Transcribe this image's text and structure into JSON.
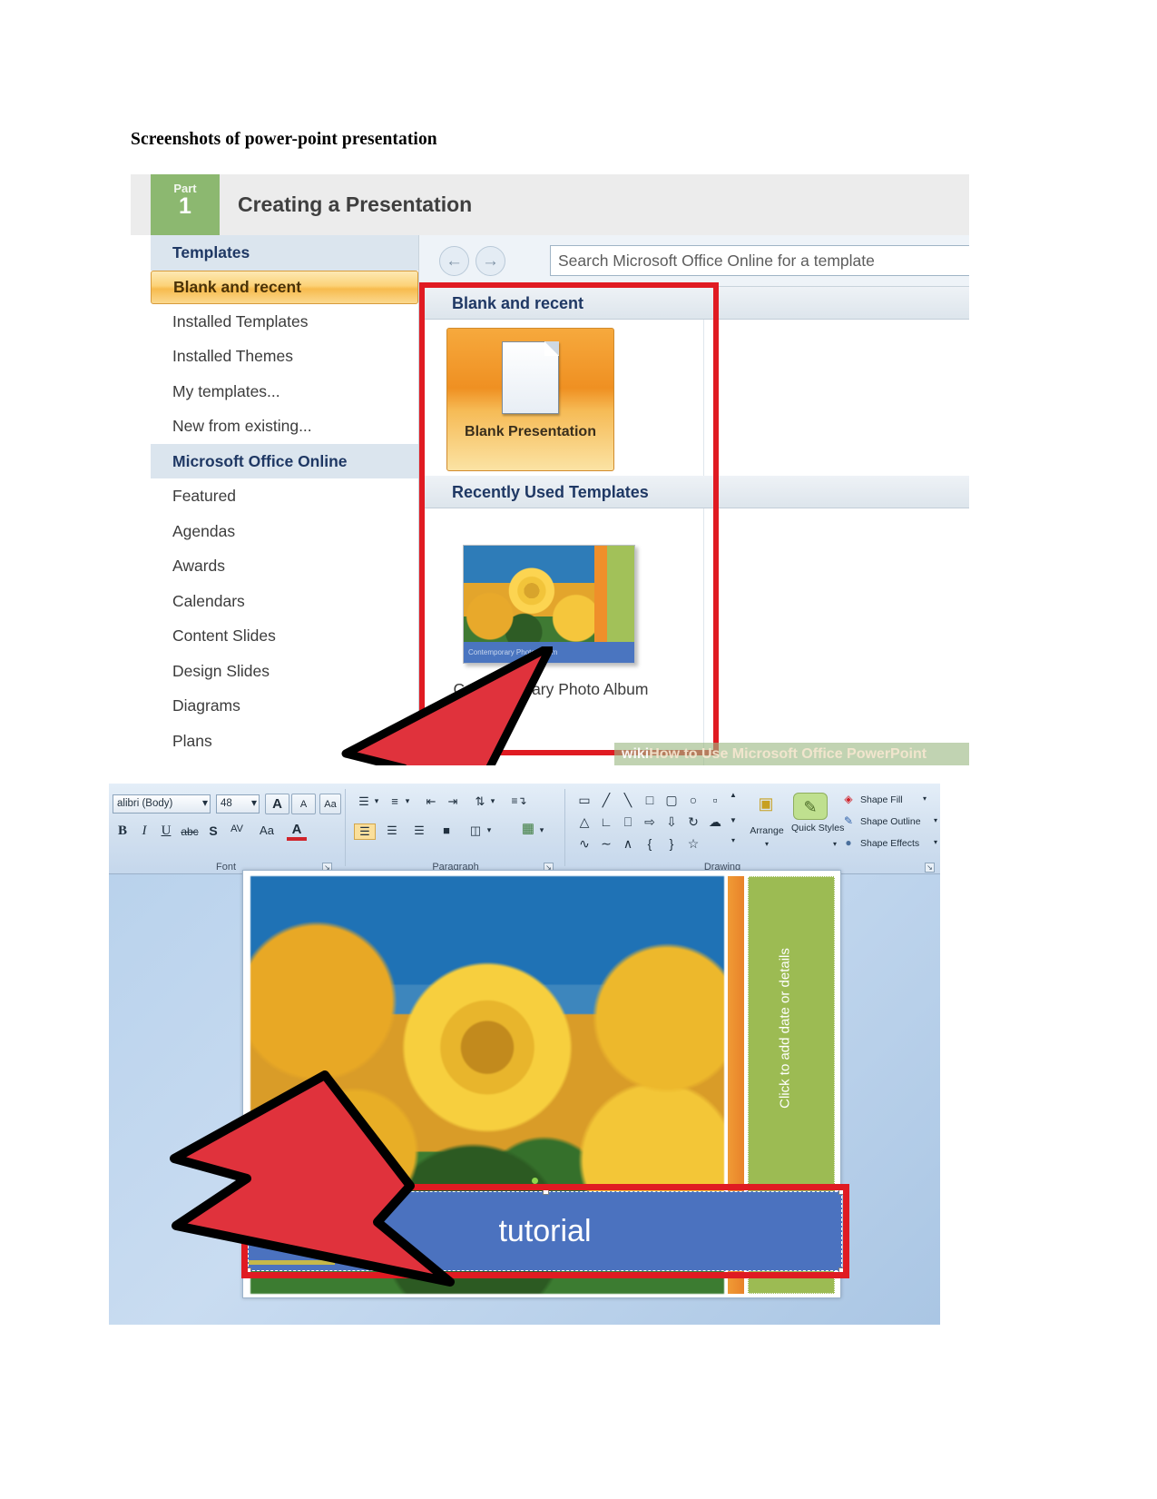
{
  "document": {
    "heading": "Screenshots of power-point presentation"
  },
  "figure1": {
    "part": {
      "label": "Part",
      "number": "1"
    },
    "title": "Creating a Presentation",
    "sidebar": {
      "items": [
        {
          "label": "Templates",
          "type": "header"
        },
        {
          "label": "Blank and recent",
          "type": "selected"
        },
        {
          "label": "Installed Templates",
          "type": "item"
        },
        {
          "label": "Installed Themes",
          "type": "item"
        },
        {
          "label": "My templates...",
          "type": "item"
        },
        {
          "label": "New from existing...",
          "type": "item"
        },
        {
          "label": "Microsoft Office Online",
          "type": "header"
        },
        {
          "label": "Featured",
          "type": "item"
        },
        {
          "label": "Agendas",
          "type": "item"
        },
        {
          "label": "Awards",
          "type": "item"
        },
        {
          "label": "Calendars",
          "type": "item"
        },
        {
          "label": "Content Slides",
          "type": "item"
        },
        {
          "label": "Design Slides",
          "type": "item"
        },
        {
          "label": "Diagrams",
          "type": "item"
        },
        {
          "label": "Plans",
          "type": "item"
        }
      ]
    },
    "toolbar": {
      "back_icon": "arrow-left-icon",
      "forward_icon": "arrow-right-icon",
      "search_placeholder": "Search Microsoft Office Online for a template"
    },
    "sections": {
      "blank_and_recent": "Blank and recent",
      "recently_used": "Recently Used Templates"
    },
    "blank_tile": {
      "label": "Blank Presentation",
      "icon": "document-icon"
    },
    "recent_template": {
      "name": "Contemporary Photo Album",
      "thumb_caption": "Contemporary Photo Album"
    },
    "watermark": {
      "wiki": "wiki",
      "how": "How to Use Microsoft Office PowerPoint"
    },
    "annotation": {
      "box_color": "#e01b22",
      "arrow_color": "#e0323c"
    }
  },
  "figure2": {
    "ribbon": {
      "font_group": {
        "label": "Font",
        "font_name": "alibri (Body)",
        "font_size": "48",
        "grow_font": "A",
        "shrink_font": "A",
        "clear_formatting": "Aa",
        "bold": "B",
        "italic": "I",
        "underline": "U",
        "strikethrough": "abc",
        "shadow": "S",
        "spacing": "AV",
        "change_case": "Aa",
        "font_color": "A"
      },
      "paragraph_group": {
        "label": "Paragraph"
      },
      "drawing_group": {
        "label": "Drawing",
        "arrange": "Arrange",
        "quick_styles": "Quick Styles",
        "shape_fill": "Shape Fill",
        "shape_outline": "Shape Outline",
        "shape_effects": "Shape Effects"
      }
    },
    "slide": {
      "date_placeholder": "Click to add date or details",
      "title_text": "tutorial"
    },
    "annotation": {
      "box_color": "#e01b22",
      "arrow_color": "#e0323c"
    }
  }
}
